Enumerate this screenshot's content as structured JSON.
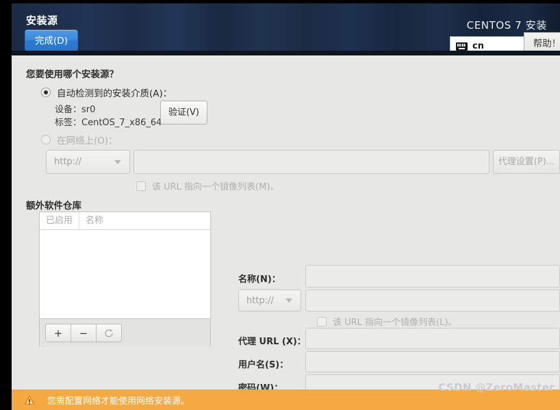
{
  "header": {
    "spoke_title": "安装源",
    "done_label": "完成(D)",
    "product_title": "CENTOS 7 安装",
    "keyboard_layout": "cn",
    "keyboard_icon": "keyboard-icon",
    "help_label": "帮助！"
  },
  "main": {
    "question": "您要使用哪个安装源？",
    "auto_detect": {
      "label": "自动检测到的安装介质(A)：",
      "selected": true,
      "device_line": "设备：sr0",
      "label_line": "标签：CentOS_7_x86_64",
      "verify_label": "验证(V)"
    },
    "network": {
      "label": "在网络上(O)：",
      "selected": false,
      "protocol": "http://",
      "url_value": "",
      "proxy_label": "代理设置(P)...",
      "mirrorlist_label": "该 URL 指向一个镜像列表(M)。",
      "mirrorlist_checked": false
    }
  },
  "extra_repos": {
    "title": "额外软件仓库",
    "columns": [
      "已启用",
      "名称"
    ],
    "rows": [],
    "toolbar": {
      "add": "+",
      "remove": "−",
      "reset_icon": "refresh-icon"
    },
    "form": {
      "name_label": "名称(N)：",
      "name_value": "",
      "protocol": "http://",
      "url_value": "",
      "mirrorlist_label": "该 URL 指向一个镜像列表(L)。",
      "mirrorlist_checked": false,
      "proxy_url_label": "代理 URL (X)：",
      "proxy_url_value": "",
      "username_label": "用户名(S)：",
      "username_value": "",
      "password_label": "密码(W)：",
      "password_value": ""
    }
  },
  "status_bar": {
    "warning_icon": "warning-triangle-icon",
    "message": "您需配置网络才能使用网络安装源。"
  },
  "watermark": {
    "text": "CSDN @ZeroMaster"
  },
  "colors": {
    "accent_blue": "#3c8ade",
    "warning_orange": "#f7a941",
    "panel_bg": "#e7e7e5",
    "header_dark": "#1b2b45"
  }
}
